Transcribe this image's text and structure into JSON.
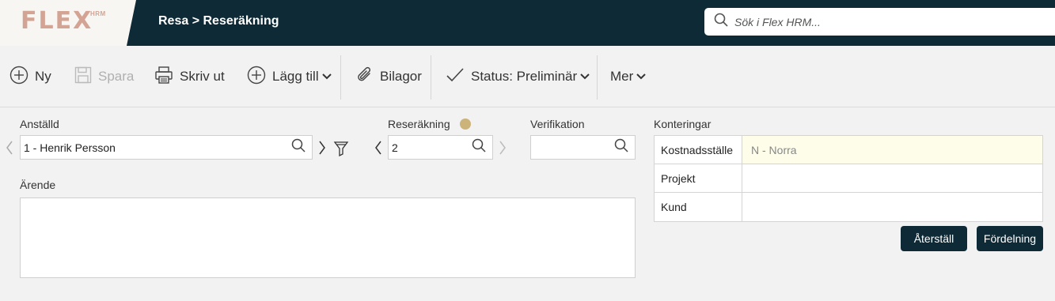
{
  "header": {
    "logo_text": "FLEX",
    "logo_sup": "HRM",
    "breadcrumb": "Resa > Reseräkning",
    "search_placeholder": "Sök i Flex HRM..."
  },
  "toolbar": {
    "new_label": "Ny",
    "save_label": "Spara",
    "print_label": "Skriv ut",
    "add_label": "Lägg till",
    "attachments_label": "Bilagor",
    "status_label": "Status: Preliminär",
    "more_label": "Mer"
  },
  "form": {
    "employee_label": "Anställd",
    "employee_value": "1 - Henrik Persson",
    "expense_label": "Reseräkning",
    "expense_value": "2",
    "verification_label": "Verifikation",
    "verification_value": "",
    "subject_label": "Ärende",
    "subject_value": ""
  },
  "konteringar": {
    "title": "Konteringar",
    "rows": [
      {
        "label": "Kostnadsställe",
        "value": "N - Norra"
      },
      {
        "label": "Projekt",
        "value": ""
      },
      {
        "label": "Kund",
        "value": ""
      }
    ],
    "reset_button": "Återställ",
    "distribution_button": "Fördelning"
  },
  "colors": {
    "header_bg": "#0e2a36",
    "logo": "#d3a393",
    "status_dot": "#cbb37a",
    "highlight_cell": "#fdfdea"
  }
}
